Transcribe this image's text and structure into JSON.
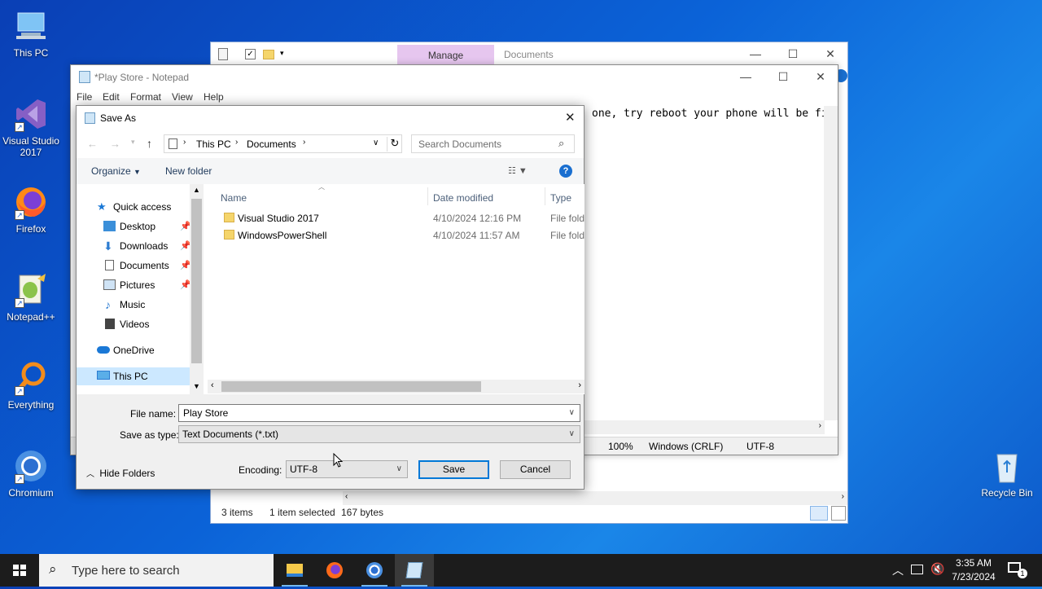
{
  "desktop": {
    "icons": [
      {
        "label": "This PC",
        "icon": "computer-icon"
      },
      {
        "label": "Visual Studio 2017",
        "icon": "visual-studio-icon"
      },
      {
        "label": "Firefox",
        "icon": "firefox-icon"
      },
      {
        "label": "Notepad++",
        "icon": "notepadpp-icon"
      },
      {
        "label": "Everything",
        "icon": "magnifier-icon"
      },
      {
        "label": "Chromium",
        "icon": "chromium-icon"
      },
      {
        "label": "Recycle Bin",
        "icon": "recycle-bin-icon"
      }
    ]
  },
  "explorer": {
    "manage_tab": "Manage",
    "location": "Documents",
    "status": {
      "items": "3 items",
      "selected": "1 item selected",
      "size": "167 bytes"
    }
  },
  "notepad": {
    "title": "*Play Store - Notepad",
    "menu": [
      "File",
      "Edit",
      "Format",
      "View",
      "Help"
    ],
    "text_visible": "one, try reboot your phone will be fi",
    "status": {
      "zoom": "100%",
      "line_ending": "Windows (CRLF)",
      "encoding": "UTF-8"
    }
  },
  "dialog": {
    "title": "Save As",
    "breadcrumb": [
      "This PC",
      "Documents"
    ],
    "search_placeholder": "Search Documents",
    "toolbar": {
      "organize": "Organize",
      "new_folder": "New folder"
    },
    "nav": [
      {
        "label": "Quick access",
        "icon": "star-icon",
        "pinned": false
      },
      {
        "label": "Desktop",
        "icon": "desktop-icon",
        "pinned": true
      },
      {
        "label": "Downloads",
        "icon": "download-icon",
        "pinned": true
      },
      {
        "label": "Documents",
        "icon": "documents-icon",
        "pinned": true
      },
      {
        "label": "Pictures",
        "icon": "pictures-icon",
        "pinned": true
      },
      {
        "label": "Music",
        "icon": "music-icon",
        "pinned": false
      },
      {
        "label": "Videos",
        "icon": "videos-icon",
        "pinned": false
      },
      {
        "label": "OneDrive",
        "icon": "cloud-icon",
        "pinned": false
      },
      {
        "label": "This PC",
        "icon": "computer-icon",
        "pinned": false
      }
    ],
    "columns": {
      "name": "Name",
      "date": "Date modified",
      "type": "Type"
    },
    "files": [
      {
        "name": "Visual Studio 2017",
        "date": "4/10/2024 12:16 PM",
        "type": "File fold"
      },
      {
        "name": "WindowsPowerShell",
        "date": "4/10/2024 11:57 AM",
        "type": "File fold"
      }
    ],
    "file_name_label": "File name:",
    "file_name_value": "Play Store",
    "save_type_label": "Save as type:",
    "save_type_value": "Text Documents (*.txt)",
    "hide_folders": "Hide Folders",
    "encoding_label": "Encoding:",
    "encoding_value": "UTF-8",
    "save": "Save",
    "cancel": "Cancel"
  },
  "taskbar": {
    "search_placeholder": "Type here to search",
    "time": "3:35 AM",
    "date": "7/23/2024",
    "notification_count": "1"
  },
  "colors": {
    "accent": "#0078d7",
    "manage_tab": "#e6c6ef",
    "taskbar": "#1c1c1c"
  }
}
